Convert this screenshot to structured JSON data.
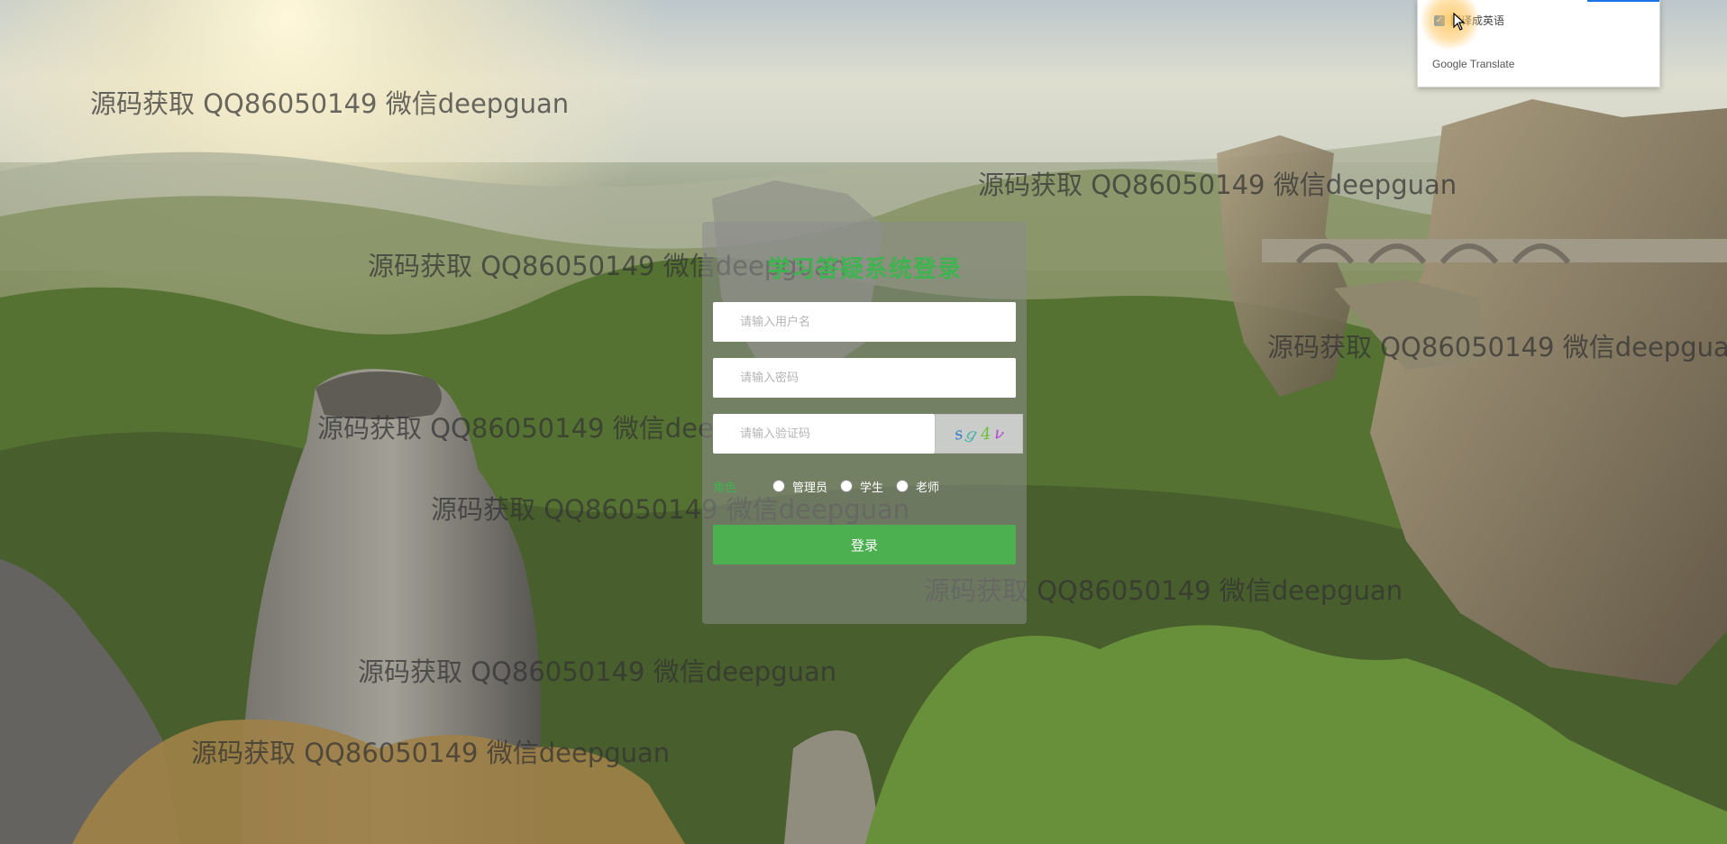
{
  "login": {
    "title": "学习答疑系统登录",
    "username_placeholder": "请输入用户名",
    "password_placeholder": "请输入密码",
    "captcha_placeholder": "请输入验证码",
    "captcha_chars": [
      "s",
      "g",
      "4",
      "v"
    ],
    "captcha_colors": [
      "#3b7ec9",
      "#4db3a8",
      "#6fbf3c",
      "#b44bd0"
    ],
    "role_label": "角色",
    "roles": [
      "管理员",
      "学生",
      "老师"
    ],
    "submit_label": "登录"
  },
  "translate_popup": {
    "option_label": "翻译成英语",
    "brand": "Google Translate"
  },
  "watermark_text": "源码获取 QQ86050149 微信deepguan",
  "colors": {
    "accent": "#4caf50",
    "title": "#3fb34f"
  }
}
